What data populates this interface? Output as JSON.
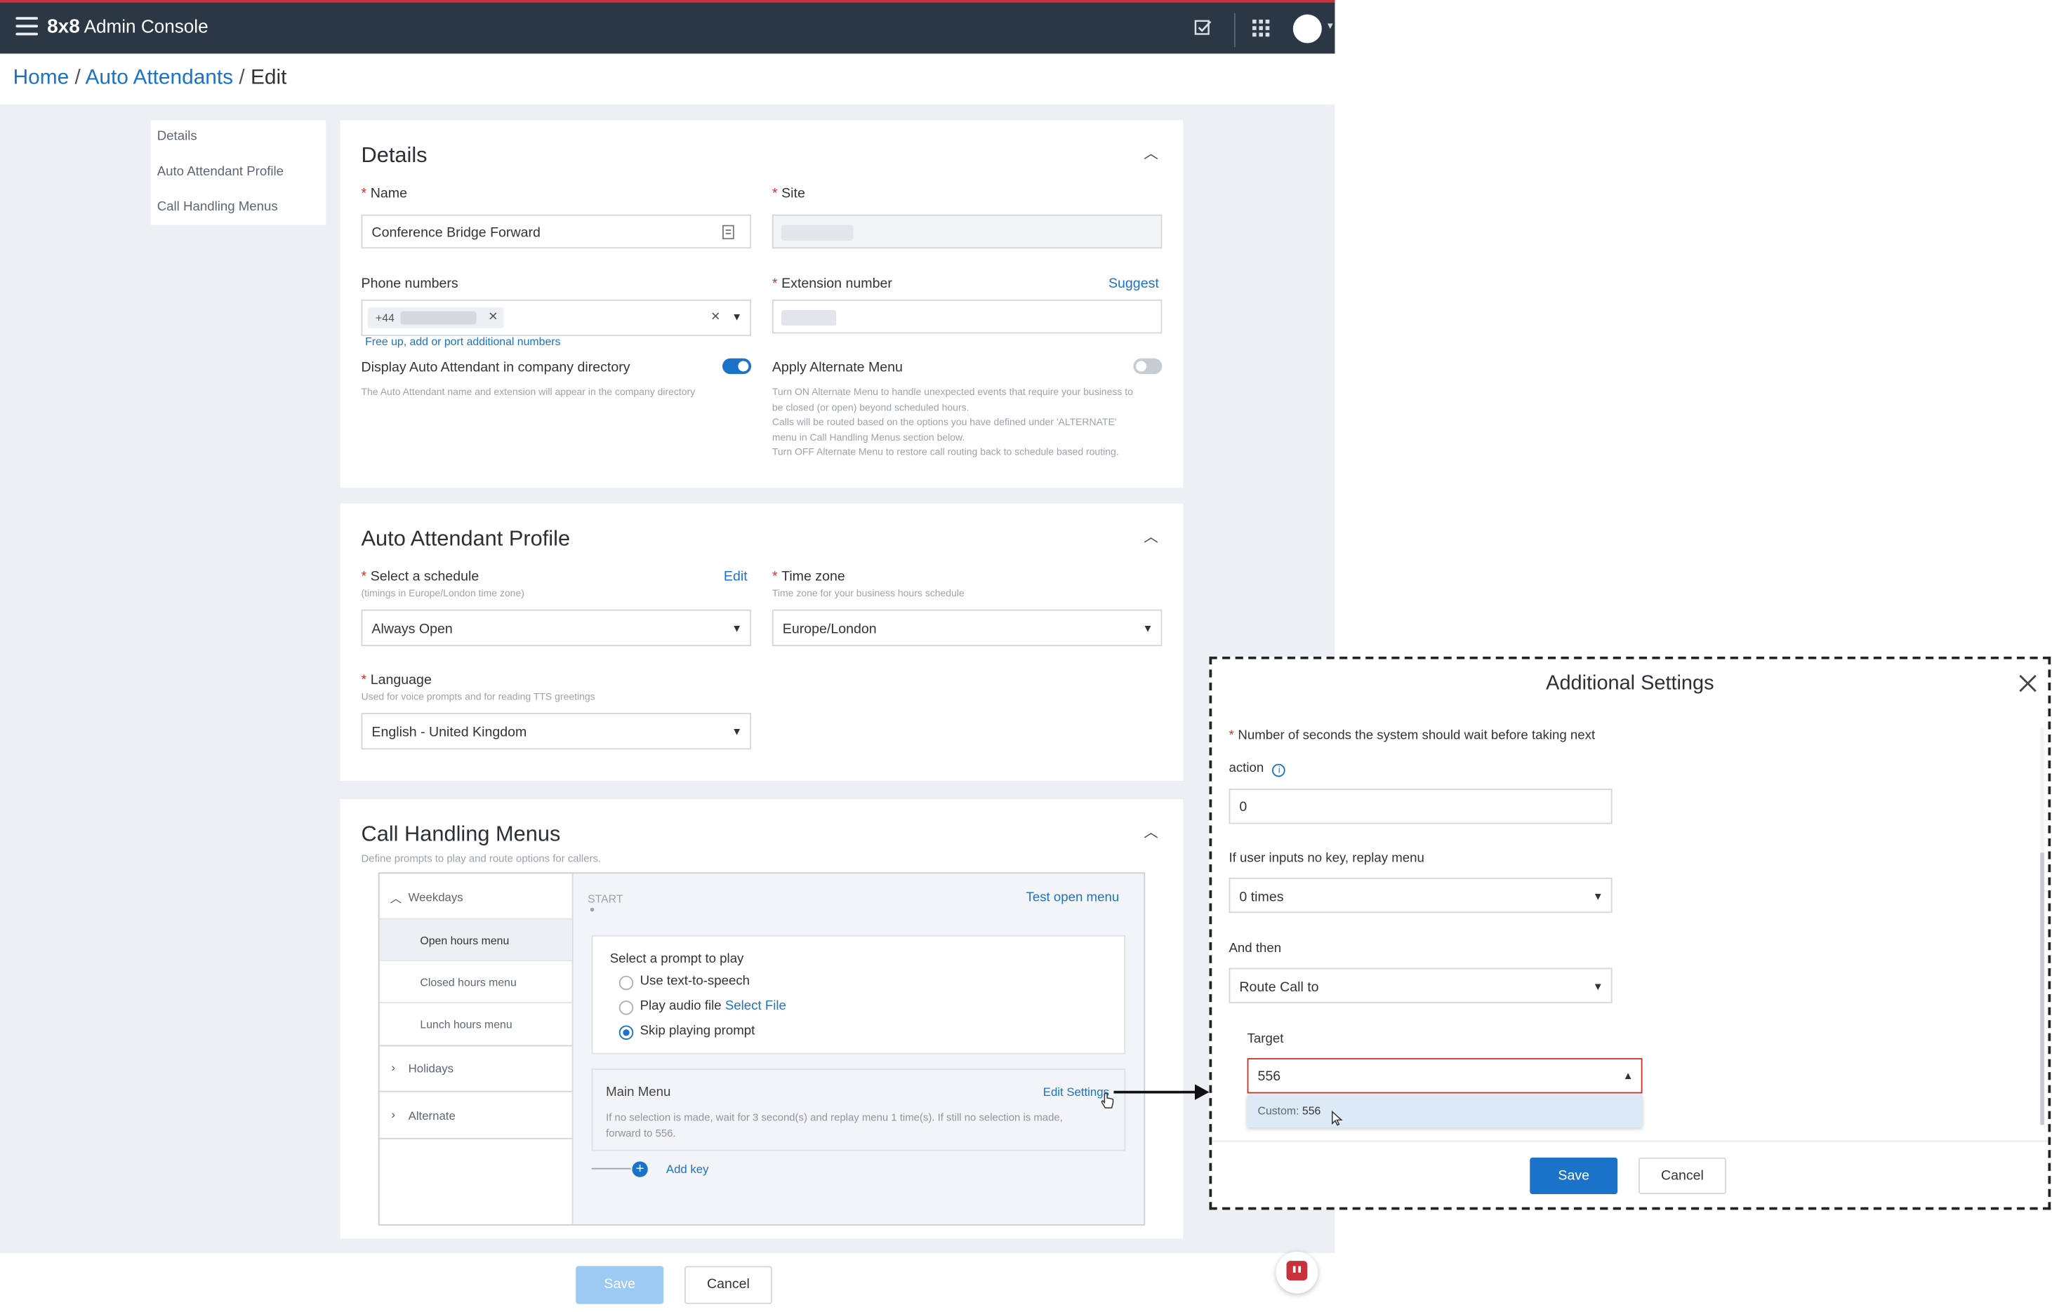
{
  "app": {
    "logo_brand": "8x8",
    "logo_title": "Admin Console"
  },
  "breadcrumb": {
    "home": "Home",
    "sep1": "/",
    "section": "Auto Attendants",
    "sep2": "/",
    "current": "Edit"
  },
  "sidenav": {
    "items": [
      "Details",
      "Auto Attendant Profile",
      "Call Handling Menus"
    ]
  },
  "details": {
    "title": "Details",
    "name_label": "Name",
    "name_value": "Conference Bridge Forward",
    "site_label": "Site",
    "phone_label": "Phone numbers",
    "phone_chip_prefix": "+44",
    "phone_link": "Free up, add or port additional numbers",
    "ext_label": "Extension number",
    "suggest": "Suggest",
    "dir_label": "Display Auto Attendant in company directory",
    "dir_hint": "The Auto Attendant name and extension will appear in the company directory",
    "alt_label": "Apply Alternate Menu",
    "alt_hint1": "Turn ON Alternate Menu to handle unexpected events that require your business to",
    "alt_hint2": "be closed (or open) beyond scheduled hours.",
    "alt_hint3": "Calls will be routed based on the options you have defined under 'ALTERNATE'",
    "alt_hint4": "menu in Call Handling Menus section below.",
    "alt_hint5": "Turn OFF Alternate Menu to restore call routing back to schedule based routing."
  },
  "profile": {
    "title": "Auto Attendant Profile",
    "schedule_label": "Select a schedule",
    "schedule_hint": "(timings in Europe/London time zone)",
    "schedule_edit": "Edit",
    "schedule_value": "Always Open",
    "tz_label": "Time zone",
    "tz_hint": "Time zone for your business hours schedule",
    "tz_value": "Europe/London",
    "lang_label": "Language",
    "lang_hint": "Used for voice prompts and for reading TTS greetings",
    "lang_value": "English - United Kingdom"
  },
  "menus": {
    "title": "Call Handling Menus",
    "subtitle": "Define prompts to play and route options for callers.",
    "weekdays": "Weekdays",
    "open_hours": "Open hours menu",
    "closed_hours": "Closed hours menu",
    "lunch_hours": "Lunch hours menu",
    "holidays": "Holidays",
    "alternate": "Alternate",
    "start": "START",
    "test_menu": "Test open menu",
    "prompt_title": "Select a prompt to play",
    "opt_tts": "Use text-to-speech",
    "opt_audio": "Play audio file",
    "select_file": "Select File",
    "opt_skip": "Skip playing prompt",
    "main_menu": "Main Menu",
    "edit_settings": "Edit Settings",
    "main_desc1": "If no selection is made, wait for 3 second(s) and replay menu 1 time(s). If still no selection is made,",
    "main_desc2": "forward to 556.",
    "add_key": "Add key"
  },
  "footer": {
    "save": "Save",
    "cancel": "Cancel"
  },
  "modal": {
    "title": "Additional Settings",
    "wait_label": "Number of seconds the system should wait before taking next",
    "wait_label2": "action",
    "wait_value": "0",
    "replay_label": "If user inputs no key, replay menu",
    "replay_value": "0 times",
    "then_label": "And then",
    "then_value": "Route Call to",
    "target_label": "Target",
    "target_value": "556",
    "option_prefix": "Custom:",
    "option_value": "556",
    "save": "Save",
    "cancel": "Cancel"
  },
  "colors": {
    "accent": "#1a73c8",
    "topbar": "#2b3745",
    "required": "#d0342c",
    "error_border": "#d0342c"
  }
}
